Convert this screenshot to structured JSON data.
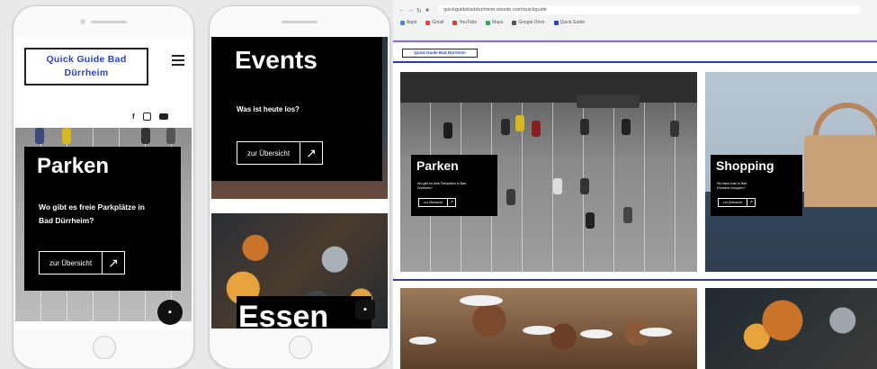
{
  "phone1": {
    "logo": [
      "Quick Guide Bad",
      "Dürrheim"
    ],
    "card_title": "Parken",
    "card_text": [
      "Wo gibt es freie Parkplätze in",
      "Bad Dürrheim?"
    ],
    "button_label": "zur Übersicht",
    "button_arrow": "↗",
    "social_icons": [
      "facebook-icon",
      "instagram-icon",
      "youtube-icon"
    ]
  },
  "phone2": {
    "events_title": "Events",
    "events_text": "Was ist heute los?",
    "button_label": "zur Übersicht",
    "button_arrow": "↗",
    "essen_title": "Essen"
  },
  "browser": {
    "url": "quickguidebaddurrheim.wixsite.com/quickguide",
    "bookmarks": [
      "Apps",
      "Gmail",
      "YouTube",
      "Maps",
      "Google Drive",
      "Quick Guide"
    ],
    "site_logo": "Quick Guide Bad Dürrheim",
    "tiles": [
      {
        "title": "Parken",
        "text": [
          "Wo gibt es freie Parkplätze in Bad",
          "Dürrheim?"
        ],
        "button": "zur Übersicht",
        "arrow": "↗"
      },
      {
        "title": "Shopping",
        "text": [
          "Wo kann man in Bad",
          "Dürrheim shoppen?"
        ],
        "button": "zur Übersicht",
        "arrow": "↗"
      }
    ]
  },
  "colors": {
    "brand_blue": "#2b3fd3",
    "card_black": "#000000",
    "accent_purple": "#8c6fd6"
  }
}
